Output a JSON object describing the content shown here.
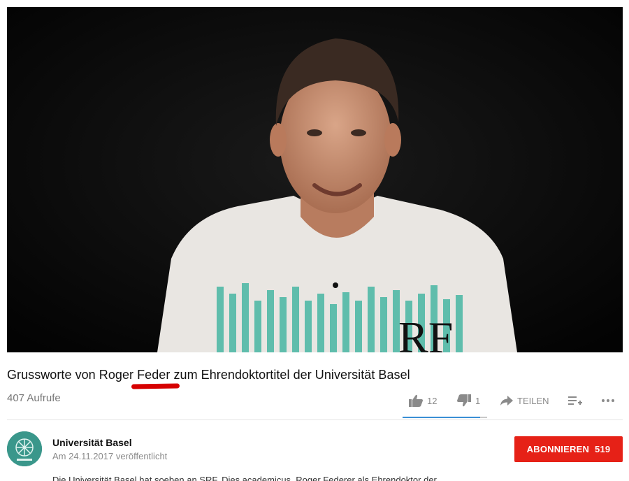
{
  "video": {
    "title_before": "Grussworte von Roger ",
    "title_highlight": "Feder",
    "title_after": " zum Ehrendoktortitel der Universität Basel",
    "views": "407 Aufrufe",
    "shirt_logo": "RF"
  },
  "actions": {
    "like_count": "12",
    "dislike_count": "1",
    "share_label": "TEILEN",
    "like_ratio": 0.92
  },
  "channel": {
    "name": "Universität Basel",
    "published": "Am 24.11.2017 veröffentlicht",
    "subscribe_label": "ABONNIEREN",
    "subscriber_count": "519"
  },
  "description": {
    "first_line": "Die Universität Basel hat soeben an SRF, Dies academicus, Roger Federer als Ehrendoktor der"
  },
  "colors": {
    "accent_red": "#e62117",
    "highlight_underline": "#d60000",
    "sentiment_blue": "#3a8fd5"
  },
  "icons": [
    "thumbs-up-icon",
    "thumbs-down-icon",
    "share-arrow-icon",
    "add-to-playlist-icon",
    "more-icon"
  ]
}
